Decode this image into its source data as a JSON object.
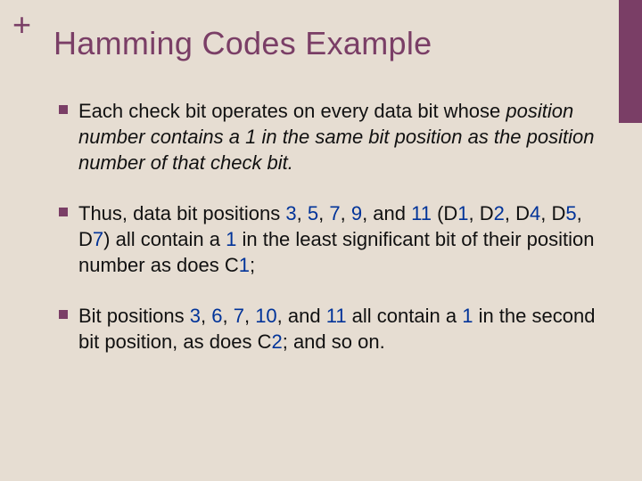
{
  "slide": {
    "plus": "+",
    "title": "Hamming Codes Example",
    "bullets": [
      {
        "lead": " Each check bit operates on every data bit whose ",
        "italic": "position number contains a 1 in the same bit position as the position number of that check bit."
      },
      {
        "p2_a": "Thus, data bit positions ",
        "p2_nums1": "3",
        "p2_b": ", ",
        "p2_nums2": "5",
        "p2_c": ", ",
        "p2_nums3": "7",
        "p2_d": ", ",
        "p2_nums4": "9",
        "p2_e": ", and ",
        "p2_nums5": "11",
        "p2_f": " (D",
        "p2_d1": "1",
        "p2_g": ", D",
        "p2_d2": "2",
        "p2_h": ", D",
        "p2_d4": "4",
        "p2_i": ", D",
        "p2_d5": "5",
        "p2_j": ", D",
        "p2_d7": "7",
        "p2_k": ") all contain a ",
        "p2_one": "1",
        "p2_l": " in the least significant bit of their position number as does C",
        "p2_c1": "1",
        "p2_end": ";"
      },
      {
        "p3_a": "Bit positions ",
        "p3_n1": "3",
        "p3_b": ", ",
        "p3_n2": "6",
        "p3_c": ", ",
        "p3_n3": "7",
        "p3_d": ", ",
        "p3_n4": "10",
        "p3_e": ", and ",
        "p3_n5": "11",
        "p3_f": " all contain a ",
        "p3_one": "1",
        "p3_g": " in the second bit position, as does C",
        "p3_c2": "2",
        "p3_h": "; and so on."
      }
    ]
  }
}
